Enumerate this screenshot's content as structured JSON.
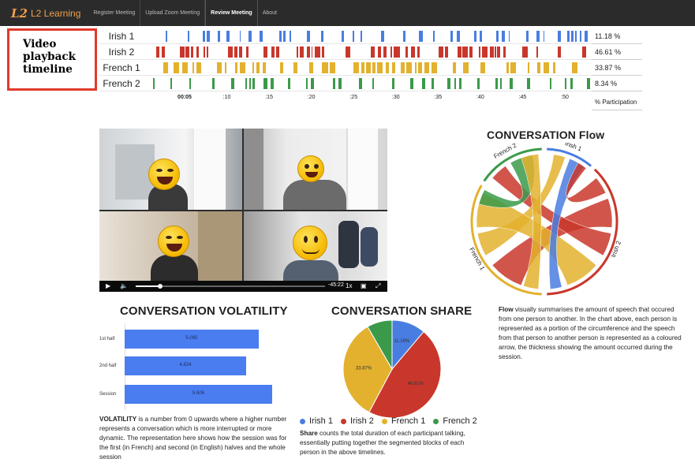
{
  "nav": {
    "logo_mark": "L2",
    "logo_text": "L2 Learning",
    "items": [
      "Register Meeting",
      "Upload Zoom Meeting",
      "Review Meeting",
      "About"
    ],
    "active_index": 2
  },
  "annotation": {
    "label": "Video playback timeline",
    "color": "#e03a2c"
  },
  "timeline": {
    "participants": [
      {
        "name": "Irish 1",
        "color": "#4a7de0",
        "percent": "11.18 %"
      },
      {
        "name": "Irish 2",
        "color": "#c9372c",
        "percent": "46.61 %"
      },
      {
        "name": "French 1",
        "color": "#e3b12e",
        "percent": "33.87 %"
      },
      {
        "name": "French 2",
        "color": "#3b9a4a",
        "percent": "8.34 %"
      }
    ],
    "ticks": [
      "00:05",
      ":10",
      ":15",
      ":20",
      ":25",
      ":30",
      ":35",
      ":40",
      ":45",
      ":50"
    ],
    "participation_label": "% Participation"
  },
  "video": {
    "time_remaining": "-45:22",
    "speed": "1x"
  },
  "volatility": {
    "title": "CONVERSATION VOLATILITY",
    "rows": [
      {
        "label": "1st half",
        "value": 5.095,
        "value_text": "5.095"
      },
      {
        "label": "2nd half",
        "value": 4.624,
        "value_text": "4.624"
      },
      {
        "label": "Session",
        "value": 5.606,
        "value_text": "5.606"
      }
    ],
    "color": "#4a7df0",
    "desc_bold": "VOLATILITY",
    "desc": " is a number from 0 upwards where a higher number represents a conversation which is more interrupted or more dynamic. The representation here shows how the session was for the first (in French) and second (in English) halves and the whole session"
  },
  "share": {
    "title": "CONVERSATION SHARE",
    "chart_data": {
      "type": "pie",
      "categories": [
        "Irish 1",
        "Irish 2",
        "French 1",
        "French 2"
      ],
      "values": [
        11.18,
        46.61,
        33.87,
        8.34
      ],
      "colors": [
        "#4a7de0",
        "#c9372c",
        "#e3b12e",
        "#3b9a4a"
      ],
      "slice_labels": [
        "11.18%",
        "46.61%",
        "33.87%",
        ""
      ]
    },
    "legend": [
      "Irish 1",
      "Irish 2",
      "French 1",
      "French 2"
    ],
    "desc_bold": "Share",
    "desc": " counts the total duration of each participant talking, essentially putting together the segmented blocks of each person in the above timelines."
  },
  "flow": {
    "title": "CONVERSATION Flow",
    "arc_labels": [
      "Irish 1",
      "Irish 2",
      "French 1",
      "French 2"
    ],
    "desc_bold": "Flow",
    "desc": " visually summarises the amount of speech that occured from one person to another. In the chart above, each person is represented as a portion of the circumference and the speech from that person to another person is represented as a coloured arrow, the thickness showing the amount occurred during the session."
  }
}
